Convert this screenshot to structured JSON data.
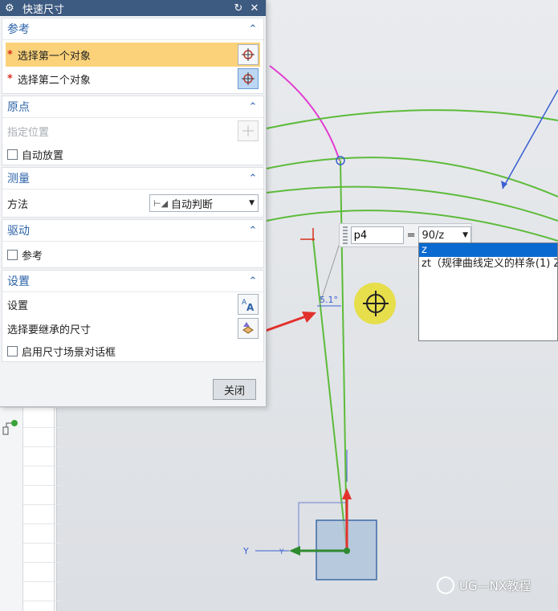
{
  "dialog": {
    "title": "快速尺寸",
    "reference": {
      "header": "参考",
      "first_object": "选择第一个对象",
      "second_object": "选择第二个对象"
    },
    "origin": {
      "header": "原点",
      "specify_location": "指定位置",
      "auto_place": "自动放置"
    },
    "measure": {
      "header": "测量",
      "method_label": "方法",
      "method_value": "自动判断"
    },
    "drive": {
      "header": "驱动",
      "reference_checkbox": "参考"
    },
    "settings": {
      "header": "设置",
      "settings_label": "设置",
      "inherit_label": "选择要继承的尺寸",
      "enable_dialog": "启用尺寸场景对话框"
    },
    "close_button": "关闭"
  },
  "onscreen_input": {
    "name": "p4",
    "equals": "=",
    "expression": "90/z"
  },
  "suggestions": [
    "z",
    "zt（规律曲线定义的样条(1) Z"
  ],
  "viewport": {
    "angle_label": "5.1°",
    "triad_y_label": "Y",
    "datum_y_label": "Y"
  },
  "watermark": "UG—NX教程",
  "colors": {
    "titlebar": "#3d5a80",
    "accent": "#2c63a9",
    "selected_row": "#fbd27a",
    "highlight": "#0a6ad0",
    "curve_green": "#5dbb3a",
    "curve_magenta": "#e23ad0",
    "arrow_red": "#e2312d"
  },
  "icons": [
    "gear-icon",
    "refresh-icon",
    "close-icon",
    "chevron-up-icon",
    "crosshair-icon",
    "text-settings-icon",
    "inherit-dimension-icon",
    "dropdown-arrow-icon",
    "navigator-icon"
  ]
}
